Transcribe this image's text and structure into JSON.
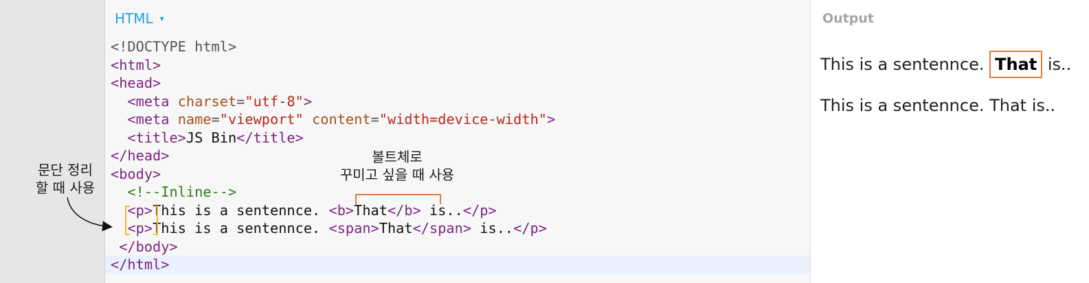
{
  "editor": {
    "panel_label": "HTML",
    "panel_caret": "▾",
    "code_lines": [
      [
        {
          "c": "d",
          "t": "<!DOCTYPE html>"
        }
      ],
      [
        {
          "c": "t",
          "t": "<html>"
        }
      ],
      [
        {
          "c": "t",
          "t": "<head>"
        }
      ],
      [
        {
          "c": "d",
          "t": "  "
        },
        {
          "c": "t",
          "t": "<meta "
        },
        {
          "c": "a",
          "t": "charset"
        },
        {
          "c": "d",
          "t": "="
        },
        {
          "c": "s",
          "t": "\"utf-8\""
        },
        {
          "c": "t",
          "t": ">"
        }
      ],
      [
        {
          "c": "d",
          "t": "  "
        },
        {
          "c": "t",
          "t": "<meta "
        },
        {
          "c": "a",
          "t": "name"
        },
        {
          "c": "d",
          "t": "="
        },
        {
          "c": "s",
          "t": "\"viewport\""
        },
        {
          "c": "d",
          "t": " "
        },
        {
          "c": "a",
          "t": "content"
        },
        {
          "c": "d",
          "t": "="
        },
        {
          "c": "s",
          "t": "\"width=device-width\""
        },
        {
          "c": "t",
          "t": ">"
        }
      ],
      [
        {
          "c": "d",
          "t": "  "
        },
        {
          "c": "t",
          "t": "<title>"
        },
        {
          "c": "x",
          "t": "JS Bin"
        },
        {
          "c": "t",
          "t": "</title>"
        }
      ],
      [
        {
          "c": "t",
          "t": "</head>"
        }
      ],
      [
        {
          "c": "t",
          "t": "<body>"
        }
      ],
      [
        {
          "c": "d",
          "t": "  "
        },
        {
          "c": "c",
          "t": "<!--Inline-->"
        }
      ],
      [
        {
          "c": "d",
          "t": "  "
        },
        {
          "c": "t",
          "t": "<p>"
        },
        {
          "c": "x",
          "t": "This is a sentennce. "
        },
        {
          "c": "t",
          "t": "<b>"
        },
        {
          "c": "x",
          "t": "That"
        },
        {
          "c": "t",
          "t": "</b>"
        },
        {
          "c": "x",
          "t": " is.."
        },
        {
          "c": "t",
          "t": "</p>"
        }
      ],
      [
        {
          "c": "d",
          "t": "  "
        },
        {
          "c": "t",
          "t": "<p>"
        },
        {
          "c": "x",
          "t": "This is a sentennce. "
        },
        {
          "c": "t",
          "t": "<span>"
        },
        {
          "c": "x",
          "t": "That"
        },
        {
          "c": "t",
          "t": "</span>"
        },
        {
          "c": "x",
          "t": " is.."
        },
        {
          "c": "t",
          "t": "</p>"
        }
      ],
      [
        {
          "c": "d",
          "t": " "
        },
        {
          "c": "t",
          "t": "</body>"
        }
      ],
      [
        {
          "c": "t",
          "t": "</html>"
        }
      ]
    ]
  },
  "output": {
    "title": "Output",
    "p1_before": "This is a sentennce. ",
    "p1_bold": "That",
    "p1_after": " is..",
    "p2": "This is a sentennce. That is.."
  },
  "annotations": {
    "left_line1": "문단 정리",
    "left_line2": "할 때 사용",
    "top_line1": "볼트체로",
    "top_line2": "꾸미고 싶을 때 사용",
    "color_orange": "#e07b39",
    "color_yellow": "#f2b531"
  }
}
